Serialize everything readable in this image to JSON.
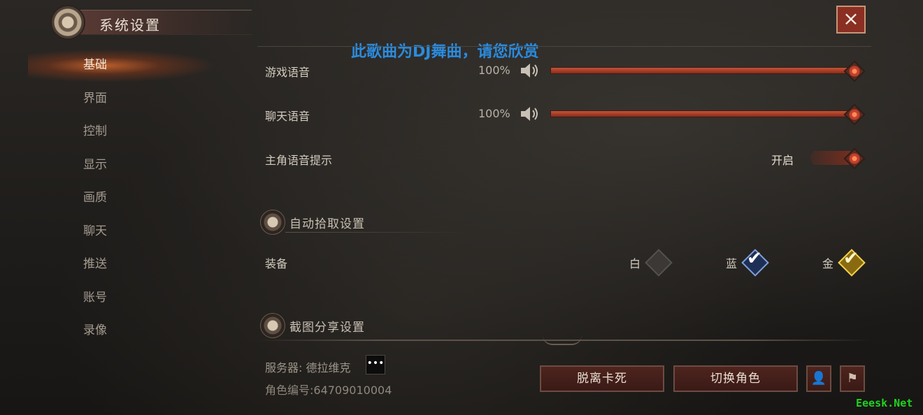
{
  "window": {
    "title": "系统设置",
    "close_icon": "×"
  },
  "notice": "此歌曲为DJ舞曲，请您欣赏",
  "sidebar": {
    "items": [
      {
        "label": "基础",
        "active": true
      },
      {
        "label": "界面"
      },
      {
        "label": "控制"
      },
      {
        "label": "显示"
      },
      {
        "label": "画质"
      },
      {
        "label": "聊天"
      },
      {
        "label": "推送"
      },
      {
        "label": "账号"
      },
      {
        "label": "录像"
      }
    ]
  },
  "audio": {
    "game_voice": {
      "label": "游戏语音",
      "value": "100%",
      "level": 1.0
    },
    "chat_voice": {
      "label": "聊天语音",
      "value": "100%",
      "level": 1.0
    },
    "hero_voice": {
      "label": "主角语音提示",
      "state": "开启"
    }
  },
  "auto_pickup": {
    "section_title": "自动拾取设置",
    "row_label": "装备",
    "options": [
      {
        "label": "白",
        "checked": false
      },
      {
        "label": "蓝",
        "checked": true
      },
      {
        "label": "金",
        "checked": true
      }
    ]
  },
  "screenshot_share": {
    "section_title": "截图分享设置"
  },
  "footer": {
    "server": "服务器: 德拉维克",
    "more_icon": "•••",
    "role_id": "角色编号:64709010004",
    "unstuck_label": "脱离卡死",
    "switch_role_label": "切换角色",
    "person_icon": "👤",
    "flag_icon": "⚑"
  },
  "watermark": "Eeesk.Net",
  "colors": {
    "accent": "#c45436",
    "notice": "#2a8ce0",
    "blue_check": "#7fa0d6",
    "gold_check": "#f2d04a"
  }
}
